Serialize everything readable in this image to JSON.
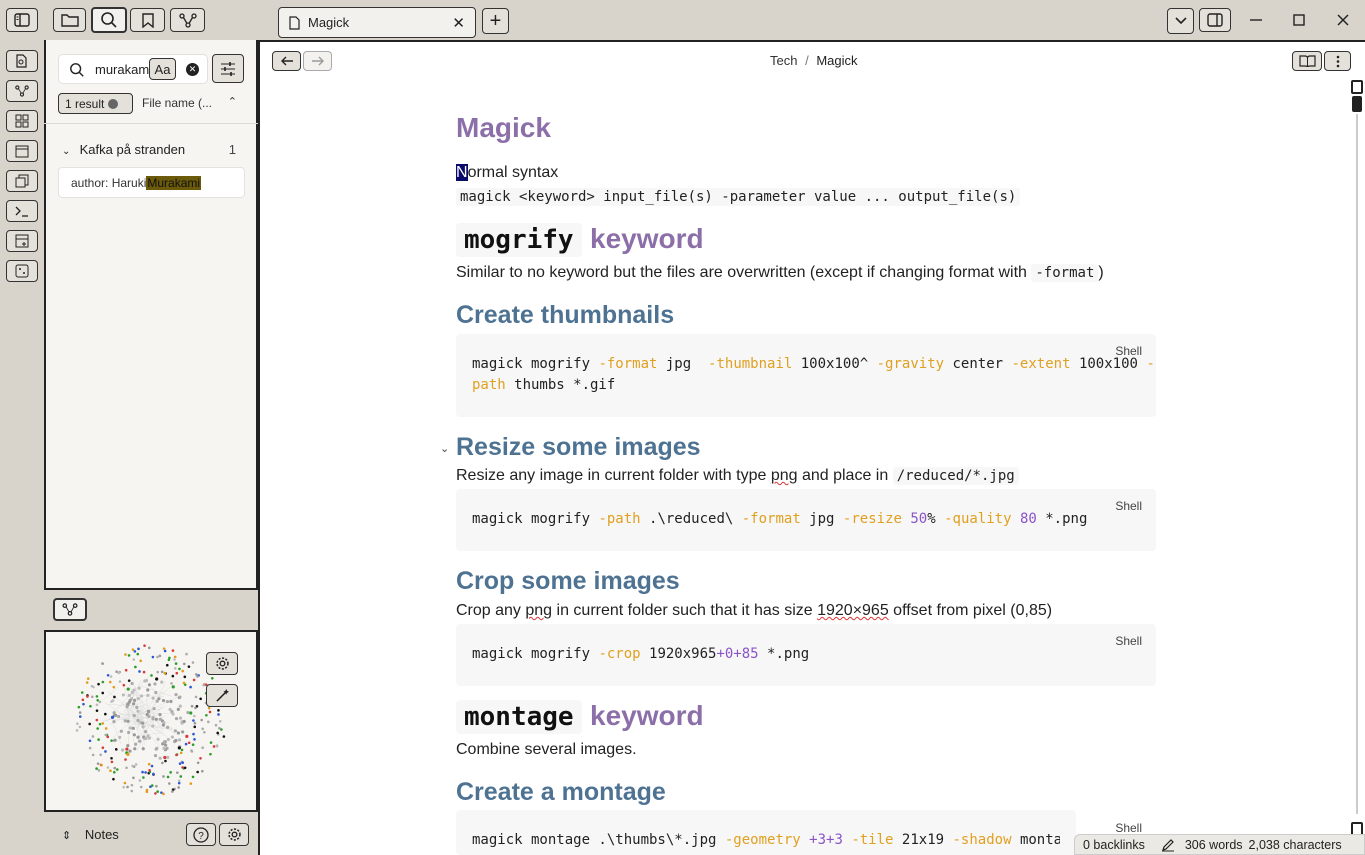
{
  "topbar": {
    "tab_title": "Magick",
    "new_tab": "+"
  },
  "search": {
    "query": "murakami",
    "match_case": "Aa",
    "result_count": "1 result",
    "sort_label": "File name (..."
  },
  "results": [
    {
      "file": "Kafka på stranden",
      "count": "1",
      "snippet_pre": "author: Haruki ",
      "snippet_match": "Murakami"
    }
  ],
  "bottom": {
    "vault_name": "Notes"
  },
  "breadcrumb": {
    "parent": "Tech",
    "sep": "/",
    "current": "Magick"
  },
  "doc": {
    "title": "Magick",
    "cursor_char": "N",
    "normal_syntax_rest": "ormal syntax",
    "normal_code": "magick <keyword> input_file(s) -parameter value ... output_file(s)",
    "mogrify_code": "mogrify",
    "keyword_word": "keyword",
    "mogrify_desc": "Similar to no keyword but the files are overwritten (except if changing format with ",
    "mogrify_desc_code": "-format",
    "mogrify_desc_end": ")",
    "h_thumbs": "Create thumbnails",
    "lang": "Shell",
    "h_resize": "Resize some images",
    "resize_desc_a": "Resize any image in current folder with type ",
    "resize_desc_png": "png",
    "resize_desc_b": " and place in ",
    "resize_desc_code": "/reduced/*.jpg",
    "h_crop": "Crop some images",
    "crop_desc_a": "Crop any ",
    "crop_desc_png": "png",
    "crop_desc_b": " in current folder such that it has size ",
    "crop_desc_size": "1920×965",
    "crop_desc_c": " offset from pixel (0,85)",
    "montage_code": "montage",
    "montage_desc": "Combine several images.",
    "h_montage": "Create a montage"
  },
  "code": {
    "thumb_l1": [
      {
        "t": "magick mogrify ",
        "c": ""
      },
      {
        "t": "-format",
        "c": "o"
      },
      {
        "t": " jpg  ",
        "c": ""
      },
      {
        "t": "-thumbnail",
        "c": "o"
      },
      {
        "t": " 100x100^ ",
        "c": ""
      },
      {
        "t": "-gravity",
        "c": "o"
      },
      {
        "t": " center ",
        "c": ""
      },
      {
        "t": "-extent",
        "c": "o"
      },
      {
        "t": " 100x100 ",
        "c": ""
      },
      {
        "t": "-",
        "c": "o"
      }
    ],
    "thumb_l2": [
      {
        "t": "path",
        "c": "o"
      },
      {
        "t": " thumbs *.gif",
        "c": ""
      }
    ],
    "resize": [
      {
        "t": "magick mogrify ",
        "c": ""
      },
      {
        "t": "-path",
        "c": "o"
      },
      {
        "t": " .\\reduced\\ ",
        "c": ""
      },
      {
        "t": "-format",
        "c": "o"
      },
      {
        "t": " jpg ",
        "c": ""
      },
      {
        "t": "-resize",
        "c": "o"
      },
      {
        "t": " ",
        "c": ""
      },
      {
        "t": "50",
        "c": "n"
      },
      {
        "t": "% ",
        "c": ""
      },
      {
        "t": "-quality",
        "c": "o"
      },
      {
        "t": " ",
        "c": ""
      },
      {
        "t": "80",
        "c": "n"
      },
      {
        "t": " *.png",
        "c": ""
      }
    ],
    "crop": [
      {
        "t": "magick mogrify ",
        "c": ""
      },
      {
        "t": "-crop",
        "c": "o"
      },
      {
        "t": " 1920x965",
        "c": ""
      },
      {
        "t": "+0+85",
        "c": "n"
      },
      {
        "t": " *.png",
        "c": ""
      }
    ],
    "montage": [
      {
        "t": "magick montage .\\thumbs\\*.jpg ",
        "c": ""
      },
      {
        "t": "-geometry",
        "c": "o"
      },
      {
        "t": " ",
        "c": ""
      },
      {
        "t": "+3+3",
        "c": "n"
      },
      {
        "t": " ",
        "c": ""
      },
      {
        "t": "-tile",
        "c": "o"
      },
      {
        "t": " 21x19 ",
        "c": ""
      },
      {
        "t": "-shadow",
        "c": "o"
      },
      {
        "t": " montage",
        "c": ""
      }
    ]
  },
  "status": {
    "backlinks": "0 backlinks",
    "words": "306 words",
    "chars": "2,038 characters"
  }
}
